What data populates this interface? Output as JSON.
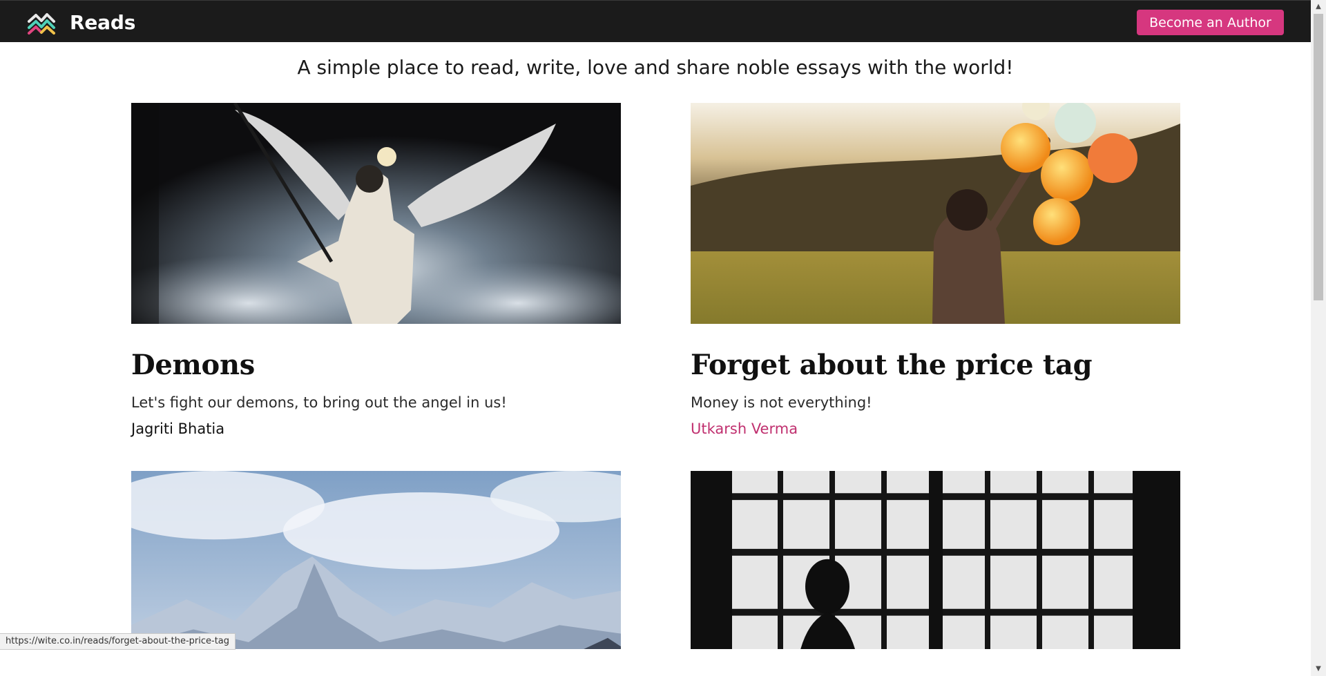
{
  "header": {
    "brand_name": "Reads",
    "cta_label": "Become an Author",
    "brand_color": "#d6377f"
  },
  "tagline": "A simple place to read, write, love and share noble essays with the world!",
  "articles": [
    {
      "title": "Demons",
      "description": "Let's fight our demons, to bring out the angel in us!",
      "author": "Jagriti Bhatia",
      "image": "winged-swordsman-photo"
    },
    {
      "title": "Forget about the price tag",
      "description": "Money is not everything!",
      "author": "Utkarsh Verma",
      "image": "girl-with-balloons-photo"
    },
    {
      "title": "",
      "description": "",
      "author": "",
      "image": "snowy-mountains-photo"
    },
    {
      "title": "",
      "description": "",
      "author": "",
      "image": "silhouette-at-window-photo"
    }
  ],
  "status_bar": {
    "url": "https://wite.co.in/reads/forget-about-the-price-tag"
  }
}
